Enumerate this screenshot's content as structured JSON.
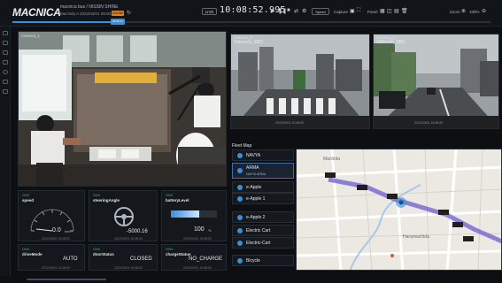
{
  "header": {
    "logo": "MACNICA",
    "route_title": "macnica bus / NISSIN SHINE",
    "route_sub": "Machida A",
    "route_sub2": "2022/03/01 09:00:00",
    "badge": "ONLINE",
    "live_label": "LIVE",
    "clock": "10:08:52.995",
    "speed_label": "Speed",
    "capture_label": "Capture",
    "panel_label": "Panel",
    "zoom_label": "Zoom",
    "zoom_value": "100%",
    "progress_fraction": 0.22,
    "progress_knob_text": "00:05:44"
  },
  "cameras": {
    "main": {
      "label": "Camera_1"
    },
    "right1": {
      "label": "Camera_2",
      "name": "Videorch_SBD",
      "timestamp": "2022/03/01 10:08:52"
    },
    "right2": {
      "label": "Camera_3",
      "name": "Videorch_SBD",
      "timestamp": "2022/03/01 10:08:52"
    }
  },
  "metrics": {
    "speed": {
      "tag": "DBW",
      "title": "speed",
      "value": "0.0",
      "unit": "km/h",
      "timestamp": "2022/03/01 10:08:52"
    },
    "steering": {
      "tag": "DBW",
      "title": "steeringAngle",
      "value": "-5000.16",
      "timestamp": "2022/03/01 10:08:52"
    },
    "battery": {
      "tag": "DBW",
      "title": "batteryLevel",
      "value": "100",
      "unit": "%",
      "level": 0.62,
      "timestamp": "2022/03/01 10:08:52"
    },
    "drive_mode": {
      "tag": "DBW",
      "title": "driveMode",
      "value": "AUTO",
      "timestamp": "2022/03/01 10:08:52"
    },
    "door_status": {
      "tag": "DBW",
      "title": "doorStatus",
      "value": "CLOSED",
      "timestamp": "2022/03/01 10:08:52"
    },
    "charge_status": {
      "tag": "DBW",
      "title": "chargeStatus",
      "value": "NO_CHARGE",
      "timestamp": "2022/03/01 10:08:52"
    }
  },
  "fleet": {
    "title": "Fleet Map",
    "items": [
      {
        "name": "NAVYA",
        "active": false
      },
      {
        "name": "ARMA",
        "sub": "NAVYA ARMA",
        "active": true
      },
      {
        "name": "e-Apple",
        "active": false
      },
      {
        "name": "e-Apple 1",
        "active": false
      },
      {
        "name": "e-Apple 2",
        "active": false
      },
      {
        "name": "Electric Cart",
        "active": false
      },
      {
        "name": "Electric-Cart",
        "active": false
      },
      {
        "name": "Bicycle",
        "active": false
      }
    ]
  },
  "map": {
    "route_color": "#6b5bd6",
    "road_color": "#ffffff",
    "water_color": "#a9c7e8",
    "street_labels": [
      {
        "text": "Machida"
      },
      {
        "text": "Haramachida"
      }
    ]
  },
  "colors": {
    "accent": "#3a8fd8",
    "ok": "#3fa55b",
    "warn": "#d9822b"
  }
}
